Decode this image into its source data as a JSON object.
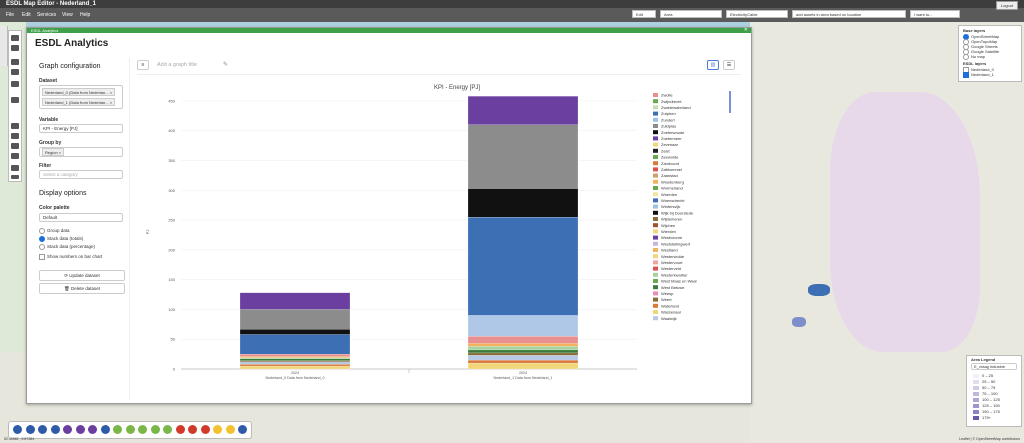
{
  "app": {
    "title": "ESDL Map Editor - Nederland_1",
    "logout": "Logout"
  },
  "menu": [
    "File",
    "Edit",
    "Services",
    "View",
    "Help"
  ],
  "topbar": {
    "mode": "Edit assets",
    "area": "Area",
    "cable": "ElectricityCable",
    "add_assets": "add assets in area based on location",
    "want_to": "I want to..."
  },
  "panel": {
    "header": "ESDL Analytics",
    "title": "ESDL Analytics",
    "graph_config": "Graph configuration",
    "dataset_label": "Dataset",
    "datasets": [
      "Nederland_0 (Data from Nederlan...",
      "Nederland_1 (Data from Nederlan..."
    ],
    "variable_label": "Variable",
    "variable_value": "KPI - Energy [PJ]",
    "group_by_label": "Group by",
    "group_by_tag": "Region",
    "filter_label": "Filter",
    "filter_placeholder": "Select a category",
    "display_options": "Display options",
    "color_palette_label": "Color palette",
    "color_palette_value": "Default",
    "radios": [
      "Group data",
      "Stack data (totals)",
      "Stack data (percentage)"
    ],
    "checkbox": "Show numbers on bar chart",
    "update_btn": "Update dataset",
    "delete_btn": "Delete dataset",
    "graph_title_placeholder": "Add a graph title"
  },
  "chart_data": {
    "type": "bar",
    "stacked": true,
    "title": "KPI - Energy [PJ]",
    "ylabel": "PJ",
    "ylim": [
      0,
      460
    ],
    "yticks": [
      0,
      50,
      100,
      150,
      200,
      250,
      300,
      350,
      400,
      450
    ],
    "categories": [
      "2024\nNederland_0 Data from Nederland_0",
      "2024\nNederland_1 Data from Nederland_1"
    ],
    "category_labels": [
      [
        "2024",
        "Nederland_0 Data from Nederland_0"
      ],
      [
        "2024",
        "Nederland_1 Data from Nederland_1"
      ]
    ],
    "series": [
      {
        "name": "Wassenaar",
        "color": "#f2d67a",
        "values": [
          5,
          10
        ]
      },
      {
        "name": "Waterland",
        "color": "#d97a3d",
        "values": [
          3,
          5
        ]
      },
      {
        "name": "Waalwijk",
        "color": "#b7c9e3",
        "values": [
          4,
          8
        ]
      },
      {
        "name": "Weert",
        "color": "#8a6e3a",
        "values": [
          2,
          4
        ]
      },
      {
        "name": "West Betuwe",
        "color": "#3a7a3a",
        "values": [
          3,
          5
        ]
      },
      {
        "name": "Westerkwartier",
        "color": "#a7d3a1",
        "values": [
          2,
          6
        ]
      },
      {
        "name": "Westland",
        "color": "#f5b25e",
        "values": [
          2,
          5
        ]
      },
      {
        "name": "Zwolle",
        "color": "#e88f8f",
        "values": [
          4,
          12
        ]
      },
      {
        "name": "Zutphen",
        "color": "#b0c8e8",
        "values": [
          0,
          35
        ]
      },
      {
        "name": "Zuidplas",
        "color": "#3c6fb4",
        "values": [
          33,
          165
        ]
      },
      {
        "name": "Zeist",
        "color": "#111111",
        "values": [
          9,
          48
        ]
      },
      {
        "name": "Zundert",
        "color": "#8c8c8c",
        "values": [
          33,
          107
        ]
      },
      {
        "name": "Zevenaar",
        "color": "#6b3fa0",
        "values": [
          28,
          48
        ]
      }
    ],
    "legend": [
      {
        "name": "Zwolle",
        "color": "#e88f8f"
      },
      {
        "name": "Zwijndrecht",
        "color": "#6aa84f"
      },
      {
        "name": "Zwartewaterland",
        "color": "#c9dbb6"
      },
      {
        "name": "Zutphen",
        "color": "#3c6fb4"
      },
      {
        "name": "Zundert",
        "color": "#9fc1e3"
      },
      {
        "name": "Zuidplas",
        "color": "#8c8c8c"
      },
      {
        "name": "Zoeterwoude",
        "color": "#111111"
      },
      {
        "name": "Zoetermeer",
        "color": "#6b3fa0"
      },
      {
        "name": "Zevenaar",
        "color": "#f2d67a"
      },
      {
        "name": "Zeist",
        "color": "#222222"
      },
      {
        "name": "Zeewolde",
        "color": "#6aa84f"
      },
      {
        "name": "Zandvoort",
        "color": "#d97a3d"
      },
      {
        "name": "Zaltbommel",
        "color": "#d9534f"
      },
      {
        "name": "Zaanstad",
        "color": "#c9a36b"
      },
      {
        "name": "Woudenberg",
        "color": "#f5b25e"
      },
      {
        "name": "Wormerland",
        "color": "#6aa84f"
      },
      {
        "name": "Woerden",
        "color": "#f2e6a0"
      },
      {
        "name": "Woensdrecht",
        "color": "#3c6fb4"
      },
      {
        "name": "Wintersvijk",
        "color": "#9fc1e3"
      },
      {
        "name": "Wijk bij Duurstede",
        "color": "#111111"
      },
      {
        "name": "Wijdemeren",
        "color": "#8a6e3a"
      },
      {
        "name": "Wijchen",
        "color": "#a0522d"
      },
      {
        "name": "Wierden",
        "color": "#f2d67a"
      },
      {
        "name": "Westvoorne",
        "color": "#6b3fa0"
      },
      {
        "name": "Weststellingwerf",
        "color": "#c9b3e3"
      },
      {
        "name": "Westland",
        "color": "#f5b25e"
      },
      {
        "name": "Westerwolde",
        "color": "#f2d67a"
      },
      {
        "name": "Westervoort",
        "color": "#f2a0a0"
      },
      {
        "name": "Westerveld",
        "color": "#d9534f"
      },
      {
        "name": "Westerkwartier",
        "color": "#a7d3a1"
      },
      {
        "name": "West Maas en Waal",
        "color": "#6aa84f"
      },
      {
        "name": "West Betuwe",
        "color": "#3a7a3a"
      },
      {
        "name": "Weesp",
        "color": "#e88fb0"
      },
      {
        "name": "Weert",
        "color": "#8a6e3a"
      },
      {
        "name": "Waterland",
        "color": "#d97a3d"
      },
      {
        "name": "Wassenaar",
        "color": "#f2d67a"
      },
      {
        "name": "Waalwijk",
        "color": "#b7c9e3"
      }
    ]
  },
  "layers": {
    "base_title": "Base layers",
    "base": [
      "OpenStreetMap",
      "OpenTopoMap",
      "Google Streets",
      "Google Satellite",
      "No map"
    ],
    "esdl_title": "ESDL layers",
    "esdl": [
      "Nederland_0",
      "Nederland_1"
    ]
  },
  "area_legend": {
    "title": "Area Legend",
    "select": "E_vraag industrie",
    "rows": [
      {
        "label": "0 – 25",
        "color": "#f3eef7"
      },
      {
        "label": "25 – 50",
        "color": "#e4dcef"
      },
      {
        "label": "50 – 75",
        "color": "#d3cae6"
      },
      {
        "label": "75 – 100",
        "color": "#c2b8dc"
      },
      {
        "label": "100 – 125",
        "color": "#b0a6d2"
      },
      {
        "label": "125 – 150",
        "color": "#9f95c8"
      },
      {
        "label": "150 – 175",
        "color": "#8e83be"
      },
      {
        "label": "175+",
        "color": "#6a5aa6"
      }
    ]
  },
  "status": {
    "coords": "52.40562 , 5.87284",
    "attribution": "Leaflet | © OpenStreetMap contributors"
  },
  "bottom_toolbar_colors": [
    "#2f5aa8",
    "#2f5aa8",
    "#2f5aa8",
    "#2f5aa8",
    "#6b3fa0",
    "#6b3fa0",
    "#6b3fa0",
    "#2f5aa8",
    "#7ab648",
    "#7ab648",
    "#7ab648",
    "#7ab648",
    "#7ab648",
    "#d13a2a",
    "#d13a2a",
    "#d13a2a",
    "#f2c230",
    "#f2c230",
    "#2f5aa8"
  ]
}
